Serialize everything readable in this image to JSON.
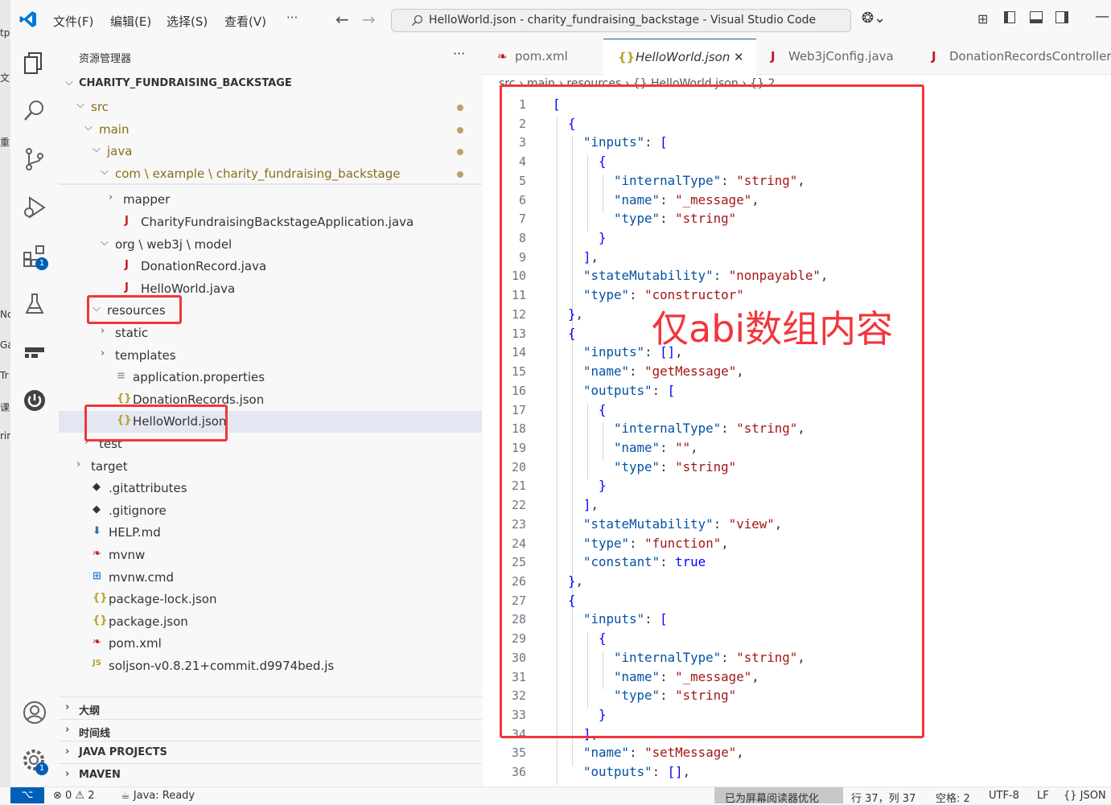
{
  "behind_window": [
    "tp",
    "文",
    "重",
    "No",
    "Ga",
    "Tr",
    "课",
    "rin"
  ],
  "titlebar": {
    "menus": [
      "文件(F)",
      "编辑(E)",
      "选择(S)",
      "查看(V)",
      "···"
    ],
    "search_text": "HelloWorld.json - charity_fundraising_backstage - Visual Studio Code"
  },
  "activity": {
    "extensions_badge": "1",
    "settings_badge": "1"
  },
  "explorer": {
    "title": "资源管理器",
    "more": "···",
    "project": "CHARITY_FUNDRAISING_BACKSTAGE",
    "rows": [
      {
        "label": "src",
        "depth": 1,
        "chev": "⌵",
        "icon": "",
        "dot": true,
        "color": "#8a6d1a"
      },
      {
        "label": "main",
        "depth": 2,
        "chev": "⌵",
        "icon": "",
        "dot": true,
        "color": "#8a6d1a"
      },
      {
        "label": "java",
        "depth": 3,
        "chev": "⌵",
        "icon": "",
        "dot": true,
        "color": "#8a6d1a"
      },
      {
        "label": "com \\ example \\ charity_fundraising_backstage",
        "depth": 4,
        "chev": "⌵",
        "icon": "",
        "dot": true,
        "color": "#8a6d1a"
      },
      {
        "label": "mapper",
        "depth": 5,
        "chev": "›",
        "icon": "",
        "dot": false,
        "color": "#333"
      },
      {
        "label": "CharityFundraisingBackstageApplication.java",
        "depth": 5,
        "chev": "",
        "icon": "J",
        "dot": false,
        "color": "#333"
      },
      {
        "label": "org \\ web3j \\ model",
        "depth": 4,
        "chev": "⌵",
        "icon": "",
        "dot": false,
        "color": "#333"
      },
      {
        "label": "DonationRecord.java",
        "depth": 5,
        "chev": "",
        "icon": "J",
        "dot": false,
        "color": "#333"
      },
      {
        "label": "HelloWorld.java",
        "depth": 5,
        "chev": "",
        "icon": "J",
        "dot": false,
        "color": "#333"
      },
      {
        "label": "resources",
        "depth": 3,
        "chev": "⌵",
        "icon": "",
        "dot": false,
        "color": "#333"
      },
      {
        "label": "static",
        "depth": 4,
        "chev": "›",
        "icon": "",
        "dot": false,
        "color": "#333"
      },
      {
        "label": "templates",
        "depth": 4,
        "chev": "›",
        "icon": "",
        "dot": false,
        "color": "#333"
      },
      {
        "label": "application.properties",
        "depth": 4,
        "chev": "",
        "icon": "≡",
        "dot": false,
        "color": "#333"
      },
      {
        "label": "DonationRecords.json",
        "depth": 4,
        "chev": "",
        "icon": "{}",
        "dot": false,
        "color": "#333"
      },
      {
        "label": "HelloWorld.json",
        "depth": 4,
        "chev": "",
        "icon": "{}",
        "dot": false,
        "color": "#333"
      },
      {
        "label": "test",
        "depth": 2,
        "chev": "›",
        "icon": "",
        "dot": false,
        "color": "#333"
      },
      {
        "label": "target",
        "depth": 1,
        "chev": "›",
        "icon": "",
        "dot": false,
        "color": "#333"
      },
      {
        "label": ".gitattributes",
        "depth": 1,
        "chev": "",
        "icon": "◆",
        "dot": false,
        "color": "#333"
      },
      {
        "label": ".gitignore",
        "depth": 1,
        "chev": "",
        "icon": "◆",
        "dot": false,
        "color": "#333"
      },
      {
        "label": "HELP.md",
        "depth": 1,
        "chev": "",
        "icon": "⬇",
        "dot": false,
        "color": "#333"
      },
      {
        "label": "mvnw",
        "depth": 1,
        "chev": "",
        "icon": "❧",
        "dot": false,
        "color": "#333"
      },
      {
        "label": "mvnw.cmd",
        "depth": 1,
        "chev": "",
        "icon": "⊞",
        "dot": false,
        "color": "#333"
      },
      {
        "label": "package-lock.json",
        "depth": 1,
        "chev": "",
        "icon": "{}",
        "dot": false,
        "color": "#333"
      },
      {
        "label": "package.json",
        "depth": 1,
        "chev": "",
        "icon": "{}",
        "dot": false,
        "color": "#333"
      },
      {
        "label": "pom.xml",
        "depth": 1,
        "chev": "",
        "icon": "❧",
        "dot": false,
        "color": "#333"
      },
      {
        "label": "soljson-v0.8.21+commit.d9974bed.js",
        "depth": 1,
        "chev": "",
        "icon": "JS",
        "dot": false,
        "color": "#333"
      }
    ],
    "sections": [
      "大纲",
      "时间线",
      "JAVA PROJECTS",
      "MAVEN"
    ]
  },
  "tabs": [
    {
      "label": "pom.xml",
      "icon": "❧",
      "active": false,
      "close": ""
    },
    {
      "label": "HelloWorld.json",
      "icon": "{}",
      "active": true,
      "close": "✕"
    },
    {
      "label": "Web3jConfig.java",
      "icon": "J",
      "active": false,
      "close": ""
    },
    {
      "label": "DonationRecordsController.j",
      "icon": "J",
      "active": false,
      "close": ""
    }
  ],
  "breadcrumb": "src › main › resources › {} HelloWorld.json › {} 2",
  "annotation": "仅abi数组内容",
  "code_lines": [
    {
      "n": "1",
      "i": 0,
      "t": "["
    },
    {
      "n": "2",
      "i": 1,
      "t": "{"
    },
    {
      "n": "3",
      "i": 2,
      "t": "\"inputs\": ["
    },
    {
      "n": "4",
      "i": 3,
      "t": "{"
    },
    {
      "n": "5",
      "i": 4,
      "t": "\"internalType\": \"string\","
    },
    {
      "n": "6",
      "i": 4,
      "t": "\"name\": \"_message\","
    },
    {
      "n": "7",
      "i": 4,
      "t": "\"type\": \"string\""
    },
    {
      "n": "8",
      "i": 3,
      "t": "}"
    },
    {
      "n": "9",
      "i": 2,
      "t": "],"
    },
    {
      "n": "10",
      "i": 2,
      "t": "\"stateMutability\": \"nonpayable\","
    },
    {
      "n": "11",
      "i": 2,
      "t": "\"type\": \"constructor\""
    },
    {
      "n": "12",
      "i": 1,
      "t": "},"
    },
    {
      "n": "13",
      "i": 1,
      "t": "{"
    },
    {
      "n": "14",
      "i": 2,
      "t": "\"inputs\": [],"
    },
    {
      "n": "15",
      "i": 2,
      "t": "\"name\": \"getMessage\","
    },
    {
      "n": "16",
      "i": 2,
      "t": "\"outputs\": ["
    },
    {
      "n": "17",
      "i": 3,
      "t": "{"
    },
    {
      "n": "18",
      "i": 4,
      "t": "\"internalType\": \"string\","
    },
    {
      "n": "19",
      "i": 4,
      "t": "\"name\": \"\","
    },
    {
      "n": "20",
      "i": 4,
      "t": "\"type\": \"string\""
    },
    {
      "n": "21",
      "i": 3,
      "t": "}"
    },
    {
      "n": "22",
      "i": 2,
      "t": "],"
    },
    {
      "n": "23",
      "i": 2,
      "t": "\"stateMutability\": \"view\","
    },
    {
      "n": "24",
      "i": 2,
      "t": "\"type\": \"function\","
    },
    {
      "n": "25",
      "i": 2,
      "t": "\"constant\": true"
    },
    {
      "n": "26",
      "i": 1,
      "t": "},"
    },
    {
      "n": "27",
      "i": 1,
      "t": "{"
    },
    {
      "n": "28",
      "i": 2,
      "t": "\"inputs\": ["
    },
    {
      "n": "29",
      "i": 3,
      "t": "{"
    },
    {
      "n": "30",
      "i": 4,
      "t": "\"internalType\": \"string\","
    },
    {
      "n": "31",
      "i": 4,
      "t": "\"name\": \"_message\","
    },
    {
      "n": "32",
      "i": 4,
      "t": "\"type\": \"string\""
    },
    {
      "n": "33",
      "i": 3,
      "t": "}"
    },
    {
      "n": "34",
      "i": 2,
      "t": "],"
    },
    {
      "n": "35",
      "i": 2,
      "t": "\"name\": \"setMessage\","
    },
    {
      "n": "36",
      "i": 2,
      "t": "\"outputs\": [],"
    }
  ],
  "status": {
    "remote": "⌥",
    "problems": "⊗ 0 ⚠ 2",
    "java": "☕ Java: Ready",
    "screen_reader": "已为屏幕阅读器优化",
    "position": "行 37，列 37",
    "spaces": "空格: 2",
    "encoding": "UTF-8",
    "eol": "LF",
    "language": "{} JSON"
  },
  "colors": {
    "accent": "#005fb8",
    "annotation": "#f0363c",
    "json_key": "#0451a5",
    "json_string": "#a31515"
  }
}
